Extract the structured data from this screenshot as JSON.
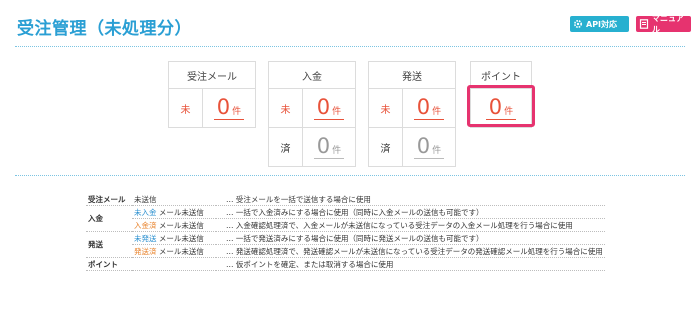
{
  "header": {
    "title": "受注管理（未処理分）",
    "api_button": "API対応",
    "manual_button": "マニュアル"
  },
  "colors": {
    "accent": "#2a9fd4",
    "highlight": "#e6336f",
    "alert": "#e8523a"
  },
  "boxes": [
    {
      "title": "受注メール",
      "rows": [
        {
          "label": "未",
          "value": "0",
          "unit": "件"
        }
      ]
    },
    {
      "title": "入金",
      "rows": [
        {
          "label": "未",
          "value": "0",
          "unit": "件"
        },
        {
          "label": "済",
          "value": "0",
          "unit": "件"
        }
      ]
    },
    {
      "title": "発送",
      "rows": [
        {
          "label": "未",
          "value": "0",
          "unit": "件"
        },
        {
          "label": "済",
          "value": "0",
          "unit": "件"
        }
      ]
    },
    {
      "title": "ポイント",
      "rows": [
        {
          "label": "",
          "value": "0",
          "unit": "件"
        }
      ]
    }
  ],
  "legend": [
    {
      "category": "受注メール",
      "tag": "",
      "status": "未送信",
      "desc": "… 受注メールを一括で送信する場合に使用"
    },
    {
      "category": "入金",
      "tag": "未入金",
      "status": "メール未送信",
      "desc": "… 一括で入金済みにする場合に使用（同時に入金メールの送信も可能です）"
    },
    {
      "category": "",
      "tag": "入金済",
      "status": "メール未送信",
      "desc": "… 入金確認処理済で、入金メールが未送信になっている受注データの入金メール処理を行う場合に使用"
    },
    {
      "category": "発送",
      "tag": "未発送",
      "status": "メール未送信",
      "desc": "… 一括で発送済みにする場合に使用（同時に発送メールの送信も可能です）"
    },
    {
      "category": "",
      "tag": "発送済",
      "status": "メール未送信",
      "desc": "… 発送確認処理済で、発送確認メールが未送信になっている受注データの発送確認メール処理を行う場合に使用"
    },
    {
      "category": "ポイント",
      "tag": "",
      "status": "",
      "desc": "… 仮ポイントを確定、または取消する場合に使用"
    }
  ]
}
